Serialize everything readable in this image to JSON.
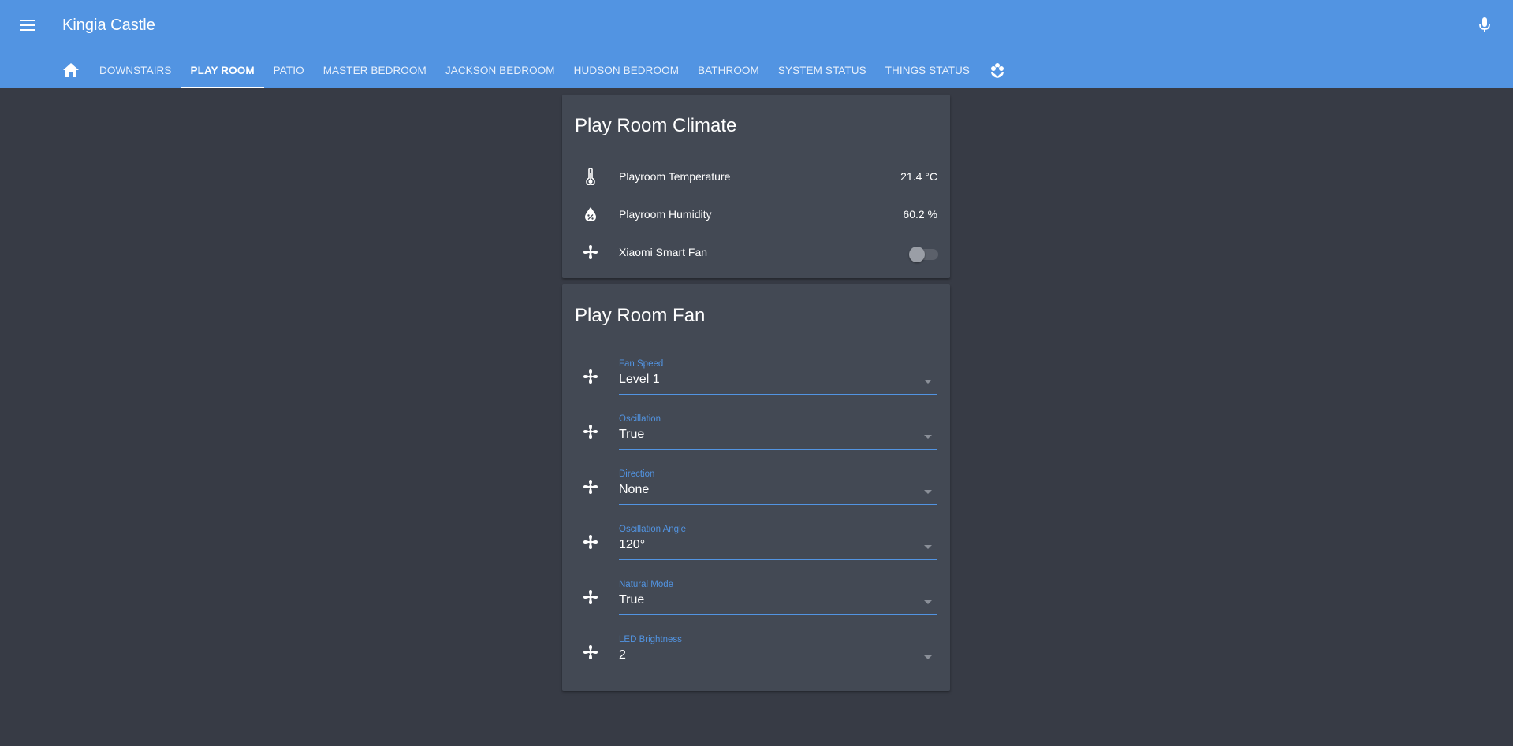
{
  "header": {
    "title": "Kingia Castle",
    "menu_icon": "menu-icon",
    "mic_icon": "microphone-icon"
  },
  "tabs": [
    {
      "icon": "home-icon"
    },
    {
      "label": "DOWNSTAIRS"
    },
    {
      "label": "PLAY ROOM",
      "active": true
    },
    {
      "label": "PATIO"
    },
    {
      "label": "MASTER BEDROOM"
    },
    {
      "label": "JACKSON BEDROOM"
    },
    {
      "label": "HUDSON BEDROOM"
    },
    {
      "label": "BATHROOM"
    },
    {
      "label": "SYSTEM STATUS"
    },
    {
      "label": "THINGS STATUS"
    },
    {
      "icon": "flower-icon"
    }
  ],
  "climate_card": {
    "title": "Play Room Climate",
    "rows": [
      {
        "icon": "thermometer-icon",
        "name": "Playroom Temperature",
        "state": "21.4 °C"
      },
      {
        "icon": "water-percent-icon",
        "name": "Playroom Humidity",
        "state": "60.2 %"
      },
      {
        "icon": "fan-icon",
        "name": "Xiaomi Smart Fan",
        "toggle_on": false
      }
    ]
  },
  "fan_card": {
    "title": "Play Room Fan",
    "selects": [
      {
        "label": "Fan Speed",
        "value": "Level 1"
      },
      {
        "label": "Oscillation",
        "value": "True"
      },
      {
        "label": "Direction",
        "value": "None"
      },
      {
        "label": "Oscillation Angle",
        "value": "120°"
      },
      {
        "label": "Natural Mode",
        "value": "True"
      },
      {
        "label": "LED Brightness",
        "value": "2"
      }
    ]
  },
  "colors": {
    "header": "#5294e2",
    "background": "#373b45",
    "card": "#434954",
    "accent": "#5294e2"
  }
}
